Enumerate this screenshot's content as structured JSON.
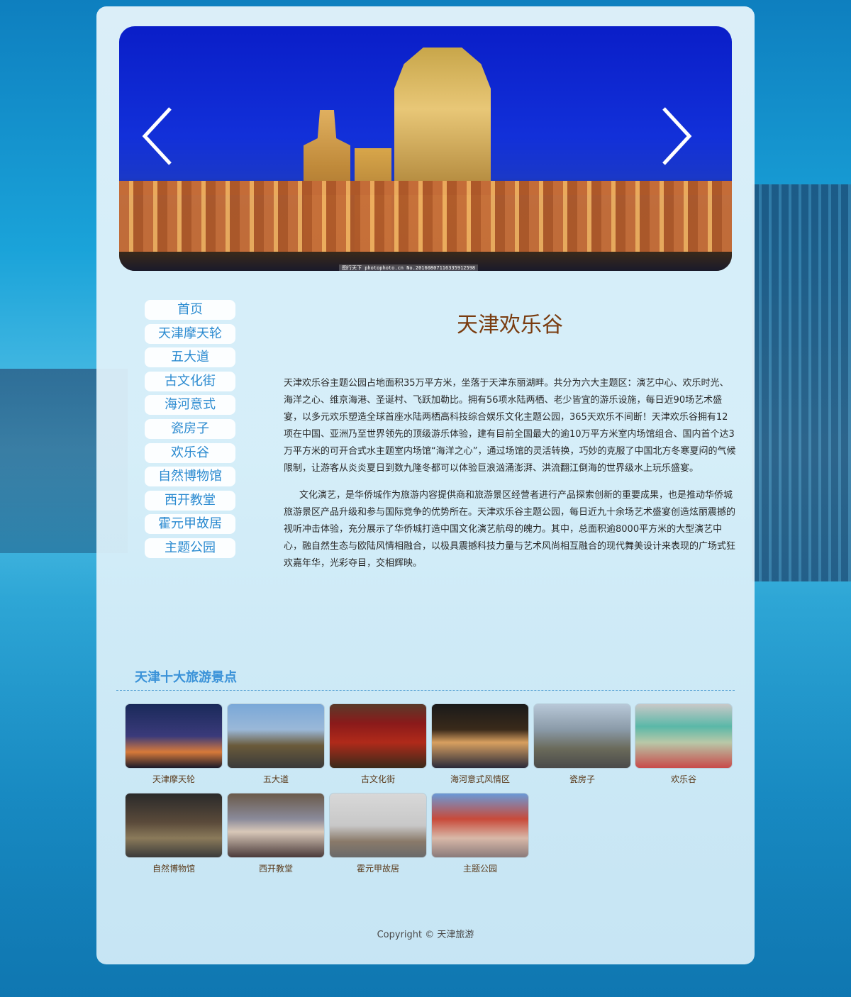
{
  "banner": {
    "credit": "图行天下 photophoto.cn  No.20160807116335912598"
  },
  "nav": {
    "items": [
      {
        "label": "首页"
      },
      {
        "label": "天津摩天轮"
      },
      {
        "label": "五大道"
      },
      {
        "label": "古文化街"
      },
      {
        "label": "海河意式"
      },
      {
        "label": "瓷房子"
      },
      {
        "label": "欢乐谷"
      },
      {
        "label": "自然博物馆"
      },
      {
        "label": "西开教堂"
      },
      {
        "label": "霍元甲故居"
      },
      {
        "label": "主题公园"
      }
    ]
  },
  "article": {
    "title": "天津欢乐谷",
    "paragraphs": [
      " 天津欢乐谷主题公园占地面积35万平方米，坐落于天津东丽湖畔。共分为六大主题区：演艺中心、欢乐时光、海洋之心、维京海港、圣诞村、飞跃加勒比。拥有56项水陆两栖、老少皆宜的游乐设施，每日近90场艺术盛宴，以多元欢乐塑造全球首座水陆两栖高科技综合娱乐文化主题公园，365天欢乐不间断！天津欢乐谷拥有12项在中国、亚洲乃至世界领先的顶级游乐体验，建有目前全国最大的逾10万平方米室内场馆组合、国内首个达3万平方米的可开合式水主题室内场馆“海洋之心”，通过场馆的灵活转换，巧妙的克服了中国北方冬寒夏闷的气候限制，让游客从炎炎夏日到数九隆冬都可以体验巨浪汹涌澎湃、洪流翻江倒海的世界级水上玩乐盛宴。",
      "文化演艺，是华侨城作为旅游内容提供商和旅游景区经营者进行产品探索创新的重要成果，也是推动华侨城旅游景区产品升级和参与国际竞争的优势所在。天津欢乐谷主题公园，每日近九十余场艺术盛宴创造炫丽震撼的视听冲击体验，充分展示了华侨城打造中国文化演艺航母的魄力。其中，总面积逾8000平方米的大型演艺中心，融自然生态与欧陆风情相融合，以极具震撼科技力量与艺术风尚相互融合的现代舞美设计来表现的广场式狂欢嘉年华，光彩夺目，交相辉映。"
    ]
  },
  "gallery": {
    "title": "天津十大旅游景点",
    "items": [
      {
        "caption": "天津摩天轮"
      },
      {
        "caption": "五大道"
      },
      {
        "caption": "古文化街"
      },
      {
        "caption": "海河意式风情区"
      },
      {
        "caption": "瓷房子"
      },
      {
        "caption": "欢乐谷"
      },
      {
        "caption": "自然博物馆"
      },
      {
        "caption": "西开教堂"
      },
      {
        "caption": "霍元甲故居"
      },
      {
        "caption": "主题公园"
      }
    ]
  },
  "footer": {
    "copyright": "Copyright © 天津旅游"
  },
  "icons": {
    "prev": "chevron-left-icon",
    "next": "chevron-right-icon"
  },
  "colors": {
    "nav_text": "#2a8ad0",
    "title": "#7a3c10",
    "section_title": "#3a92d8"
  }
}
